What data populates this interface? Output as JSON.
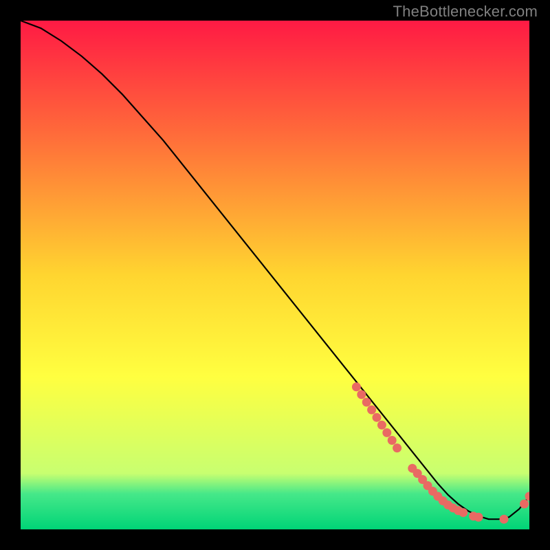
{
  "attribution": "TheBottlenecker.com",
  "colors": {
    "bg": "#000000",
    "gradient_top": "#ff1a44",
    "gradient_mid_upper": "#ff6a3a",
    "gradient_mid": "#ffd530",
    "gradient_mid_lower": "#ffff40",
    "gradient_green1": "#c8ff70",
    "gradient_green2": "#46e889",
    "gradient_bottom": "#00d477",
    "curve": "#000000",
    "marker": "#e96a63"
  },
  "chart_data": {
    "type": "line",
    "title": "",
    "xlabel": "",
    "ylabel": "",
    "xlim": [
      0,
      100
    ],
    "ylim": [
      0,
      100
    ],
    "series": [
      {
        "name": "curve",
        "x": [
          0,
          4,
          8,
          12,
          16,
          20,
          24,
          28,
          32,
          36,
          40,
          44,
          48,
          52,
          56,
          60,
          64,
          68,
          72,
          74,
          76,
          78,
          80,
          82,
          84,
          86,
          88,
          90,
          92,
          94,
          96,
          98,
          100
        ],
        "y": [
          100,
          98.5,
          96,
          93,
          89.5,
          85.5,
          81,
          76.5,
          71.5,
          66.5,
          61.5,
          56.5,
          51.5,
          46.5,
          41.5,
          36.5,
          31.5,
          26.5,
          21.5,
          19,
          16.5,
          14,
          11.5,
          9,
          6.8,
          5,
          3.6,
          2.6,
          2.0,
          2.0,
          2.4,
          4.0,
          6.5
        ]
      }
    ],
    "markers": {
      "x": [
        66,
        67,
        68,
        69,
        70,
        71,
        72,
        73,
        74,
        77,
        78,
        79,
        80,
        81,
        82,
        83,
        84,
        85,
        86,
        87,
        89,
        90,
        95,
        99,
        100
      ],
      "y": [
        28,
        26.5,
        25,
        23.5,
        22,
        20.5,
        19,
        17.5,
        16,
        12,
        11,
        9.8,
        8.6,
        7.5,
        6.5,
        5.6,
        4.8,
        4.2,
        3.7,
        3.3,
        2.6,
        2.4,
        2.0,
        5.0,
        6.5
      ]
    }
  }
}
